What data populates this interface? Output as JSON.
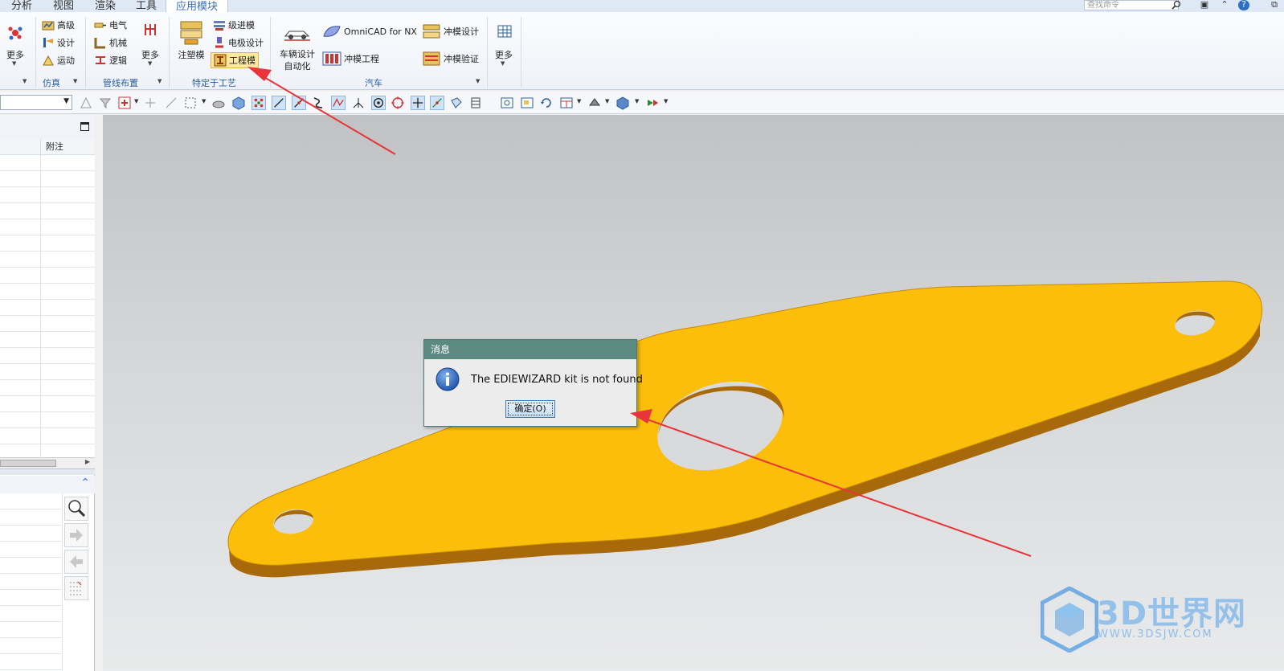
{
  "menu": {
    "tabs": [
      "分析",
      "视图",
      "渲染",
      "工具",
      "应用模块"
    ],
    "active_tab": "应用模块",
    "search_placeholder": "查找命令"
  },
  "ribbon": {
    "more_label": "更多",
    "sim_items": [
      "高级",
      "设计",
      "运动"
    ],
    "sim_group": "仿真",
    "pipe_items": [
      "电气",
      "机械",
      "逻辑"
    ],
    "pipe_more": "更多",
    "pipe_group": "管线布置",
    "process_big": "注塑模",
    "process_items": [
      "级进模",
      "电极设计",
      "工程模"
    ],
    "process_group": "特定于工艺",
    "auto_big": [
      "车辆设计",
      "自动化"
    ],
    "auto_items": [
      "OmniCAD for NX",
      "冲模设计",
      "冲模工程",
      "冲模验证"
    ],
    "auto_group": "汽车",
    "last_more": "更多"
  },
  "navigator": {
    "column_header": "附注"
  },
  "dialog": {
    "title": "消息",
    "message": "The EDIEWIZARD kit is not found",
    "ok_label": "确定(O)"
  },
  "watermark": {
    "brand": "3D世界网",
    "url": "WWW.3DSJW.COM"
  },
  "colors": {
    "part_fill": "#fbbe0b",
    "part_side": "#a8690a",
    "dialog_title": "#5c8a82",
    "arrow": "#e8343a",
    "accent": "#3b6fb6"
  }
}
